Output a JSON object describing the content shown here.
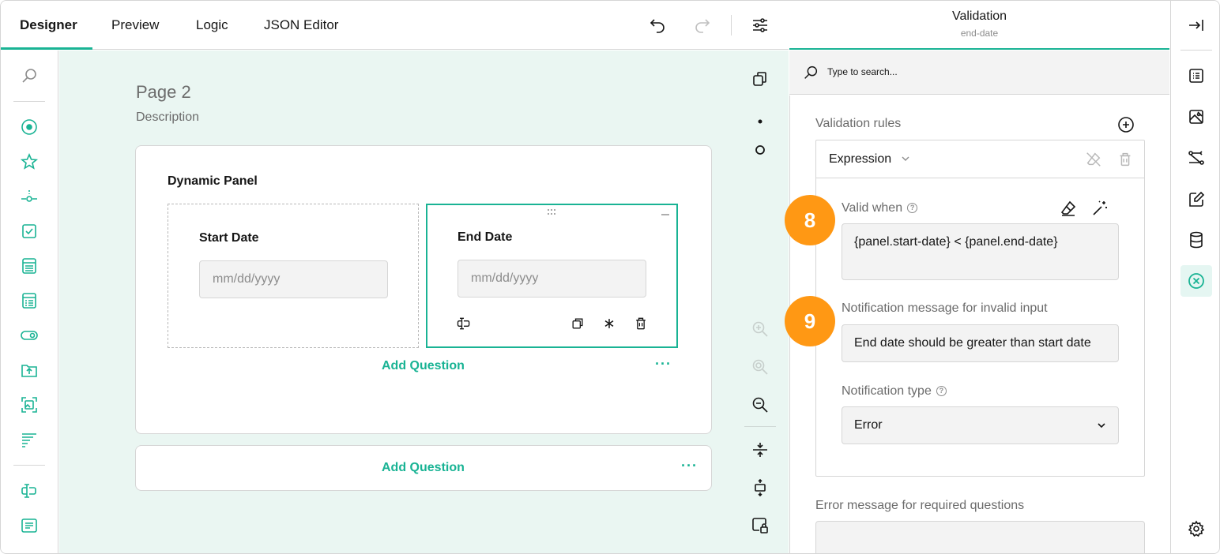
{
  "topbar": {
    "tabs": [
      {
        "label": "Designer"
      },
      {
        "label": "Preview"
      },
      {
        "label": "Logic"
      },
      {
        "label": "JSON Editor"
      }
    ],
    "accent_color": "#19b394"
  },
  "canvas": {
    "page_title": "Page 2",
    "page_description": "Description",
    "panel_title": "Dynamic Panel",
    "questions": [
      {
        "title": "Start Date",
        "placeholder": "mm/dd/yyyy"
      },
      {
        "title": "End Date",
        "placeholder": "mm/dd/yyyy"
      }
    ],
    "add_question_label": "Add Question",
    "more_label": "···"
  },
  "property_grid": {
    "title": "Validation",
    "subtitle": "end-date",
    "search_placeholder": "Type to search...",
    "validation_rules_label": "Validation rules",
    "rule_type": "Expression",
    "valid_when_label": "Valid when",
    "valid_when_value": "{panel.start-date} < {panel.end-date}",
    "notification_message_label": "Notification message for invalid input",
    "notification_message_value": "End date should be greater than start date",
    "notification_type_label": "Notification type",
    "notification_type_value": "Error",
    "required_error_label": "Error message for required questions",
    "step_badges": [
      "8",
      "9"
    ],
    "badge_color": "#ff9814"
  }
}
